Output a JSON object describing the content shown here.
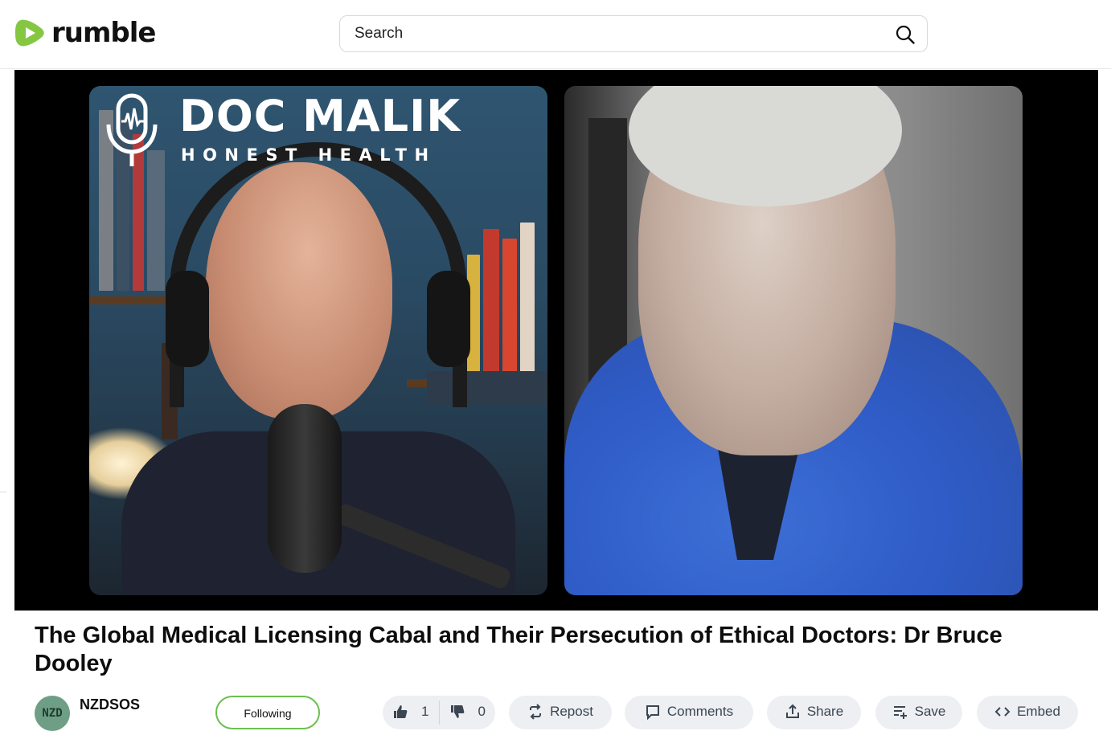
{
  "header": {
    "logo_text": "rumble",
    "search_placeholder": "Search"
  },
  "video": {
    "overlay_title": "DOC MALIK",
    "overlay_subtitle": "HONEST HEALTH"
  },
  "title": "The Global Medical Licensing Cabal and Their Persecution of Ethical Doctors: Dr Bruce Dooley",
  "channel": {
    "avatar_text": "NZD",
    "name": "NZDSOS",
    "follow_label": "Following"
  },
  "actions": {
    "upvotes": "1",
    "downvotes": "0",
    "repost": "Repost",
    "comments": "Comments",
    "share": "Share",
    "save": "Save",
    "embed": "Embed"
  },
  "colors": {
    "brand_green": "#85c742",
    "follow_border": "#6cbf4f",
    "pill_bg": "#edeff2"
  }
}
